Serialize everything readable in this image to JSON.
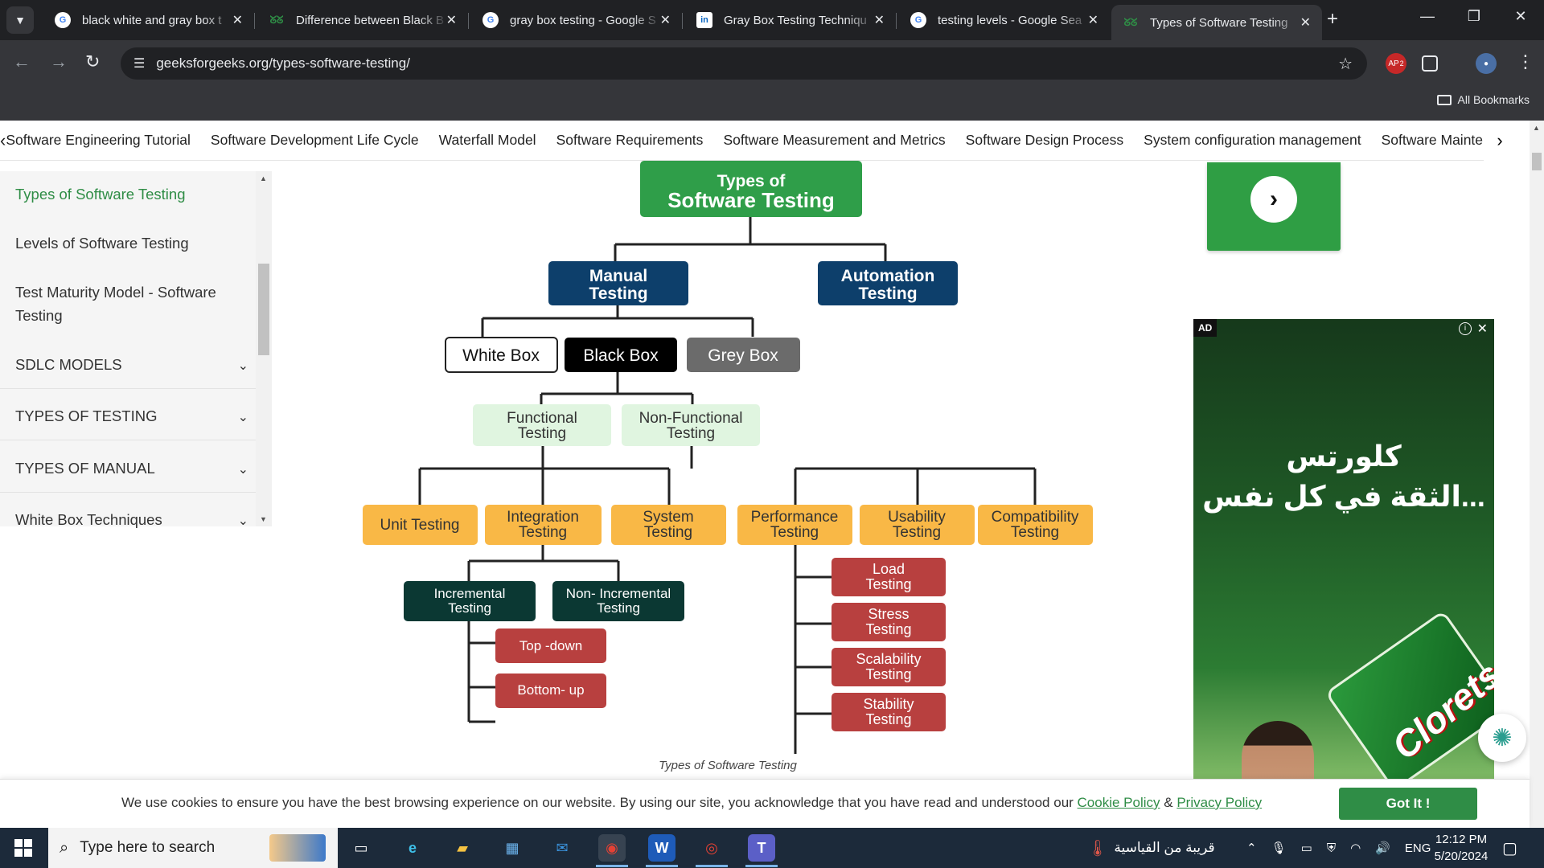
{
  "browser": {
    "tabs": [
      {
        "title": "black white and gray box t",
        "favicon": "google"
      },
      {
        "title": "Difference between Black B",
        "favicon": "gfg"
      },
      {
        "title": "gray box testing - Google S",
        "favicon": "google"
      },
      {
        "title": "Gray Box Testing Techniqu",
        "favicon": "linkedin"
      },
      {
        "title": "testing levels - Google Sea",
        "favicon": "google"
      },
      {
        "title": "Types of Software Testing",
        "favicon": "gfg"
      }
    ],
    "url": "geeksforgeeks.org/types-software-testing/",
    "extension_badge": "2",
    "bookmarks_label": "All Bookmarks"
  },
  "topnav": {
    "items": [
      "Software Engineering Tutorial",
      "Software Development Life Cycle",
      "Waterfall Model",
      "Software Requirements",
      "Software Measurement and Metrics",
      "Software Design Process",
      "System configuration management",
      "Software Maintenan"
    ]
  },
  "sidebar": {
    "items": [
      {
        "label": "Types of Software Testing",
        "active": true
      },
      {
        "label": "Levels of Software Testing"
      },
      {
        "label": "Test Maturity Model - Software Testing"
      }
    ],
    "sections": [
      "SDLC MODELS",
      "TYPES OF TESTING",
      "TYPES OF MANUAL",
      "White Box Techniques"
    ]
  },
  "diagram": {
    "root": "Types of Software Testing",
    "root_line1": "Types of",
    "root_line2": "Software Testing",
    "level1": [
      "Manual",
      "Testing",
      "Automation",
      "Testing"
    ],
    "boxes": [
      "White Box",
      "Black Box",
      "Grey Box"
    ],
    "func": [
      "Functional",
      "Testing"
    ],
    "nonfunc": [
      "Non-Functional",
      "Testing"
    ],
    "functional_children": [
      [
        "Unit Testing"
      ],
      [
        "Integration",
        "Testing"
      ],
      [
        "System",
        "Testing"
      ]
    ],
    "nonfunctional_children": [
      [
        "Performance",
        "Testing"
      ],
      [
        "Usability",
        "Testing"
      ],
      [
        "Compatibility",
        "Testing"
      ]
    ],
    "integration_children": [
      [
        "Incremental",
        "Testing"
      ],
      [
        "Non- Incremental",
        "Testing"
      ]
    ],
    "incremental_children": [
      "Top -down",
      "Bottom- up"
    ],
    "performance_children": [
      [
        "Load",
        "Testing"
      ],
      [
        "Stress",
        "Testing"
      ],
      [
        "Scalability",
        "Testing"
      ],
      [
        "Stability",
        "Testing"
      ]
    ],
    "caption": "Types of Software Testing",
    "colors": {
      "root": "#2f9e49",
      "level1": "#0d3f6b",
      "white_box": "#ffffff",
      "black_box": "#000000",
      "grey_box": "#6b6b6b",
      "func": "#e0f5e0",
      "orange": "#f9b846",
      "dark_green": "#0b3833",
      "red": "#b8403f"
    }
  },
  "ad": {
    "label": "AD",
    "arabic_line1": "كلورتس",
    "arabic_line2": "الثقة في كل نفس...",
    "brand": "Clorets"
  },
  "cookie": {
    "text": "We use cookies to ensure you have the best browsing experience on our website. By using our site, you acknowledge that you have read and understood our ",
    "link1": "Cookie Policy",
    "amp": " & ",
    "link2": "Privacy Policy",
    "button": "Got It !"
  },
  "taskbar": {
    "search_placeholder": "Type here to search",
    "weather_text": "قريبة من القياسية",
    "language": "ENG",
    "time": "12:12 PM",
    "date": "5/20/2024"
  }
}
